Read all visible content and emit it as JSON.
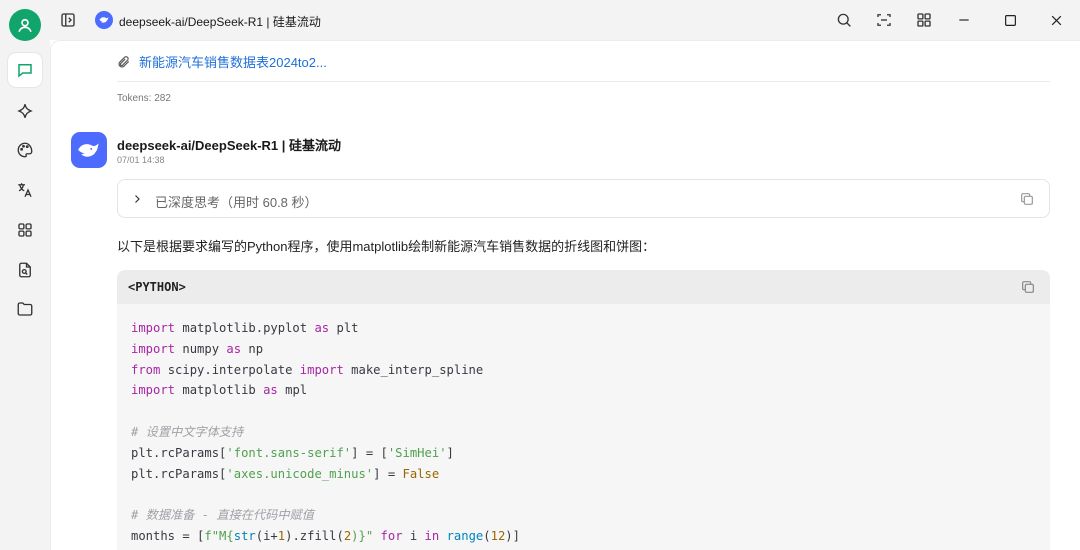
{
  "window": {
    "title": "deepseek-ai/DeepSeek-R1 | 硅基流动"
  },
  "sidebar": {
    "items": [
      {
        "icon": "chat-icon",
        "active": true
      },
      {
        "icon": "sparkle-icon"
      },
      {
        "icon": "palette-icon"
      },
      {
        "icon": "translate-icon"
      },
      {
        "icon": "apps-grid-icon"
      },
      {
        "icon": "document-search-icon"
      },
      {
        "icon": "folder-icon"
      }
    ]
  },
  "message": {
    "attachment_label": "新能源汽车销售数据表2024to2...",
    "tokens": "Tokens: 282"
  },
  "reply": {
    "model_name": "deepseek-ai/DeepSeek-R1 | 硅基流动",
    "timestamp": "07/01 14:38",
    "thinking_label": "已深度思考（用时 60.8 秒）",
    "intro": "以下是根据要求编写的Python程序，使用matplotlib绘制新能源汽车销售数据的折线图和饼图：",
    "code_language": "<PYTHON>",
    "code": {
      "l1a": "import",
      "l1b": " matplotlib.pyplot ",
      "l1c": "as",
      "l1d": " plt",
      "l2a": "import",
      "l2b": " numpy ",
      "l2c": "as",
      "l2d": " np",
      "l3a": "from",
      "l3b": " scipy.interpolate ",
      "l3c": "import",
      "l3d": " make_interp_spline",
      "l4a": "import",
      "l4b": " matplotlib ",
      "l4c": "as",
      "l4d": " mpl",
      "l6": "# 设置中文字体支持",
      "l7a": "plt.rcParams[",
      "l7b": "'font.sans-serif'",
      "l7c": "] = [",
      "l7d": "'SimHei'",
      "l7e": "]",
      "l8a": "plt.rcParams[",
      "l8b": "'axes.unicode_minus'",
      "l8c": "] = ",
      "l8d": "False",
      "l10": "# 数据准备 - 直接在代码中赋值",
      "l11a": "months = [",
      "l11b": "f\"M{",
      "l11c": "str",
      "l11d": "(i+",
      "l11e": "1",
      "l11f": ").zfill(",
      "l11g": "2",
      "l11h": ")}\"",
      "l11i": " ",
      "l11j": "for",
      "l11k": " i ",
      "l11l": "in",
      "l11m": " ",
      "l11n": "range",
      "l11o": "(",
      "l11p": "12",
      "l11q": ")]"
    }
  },
  "colors": {
    "accent": "#11a56c",
    "brand": "#4d6bfe",
    "link": "#1e6fd9"
  }
}
